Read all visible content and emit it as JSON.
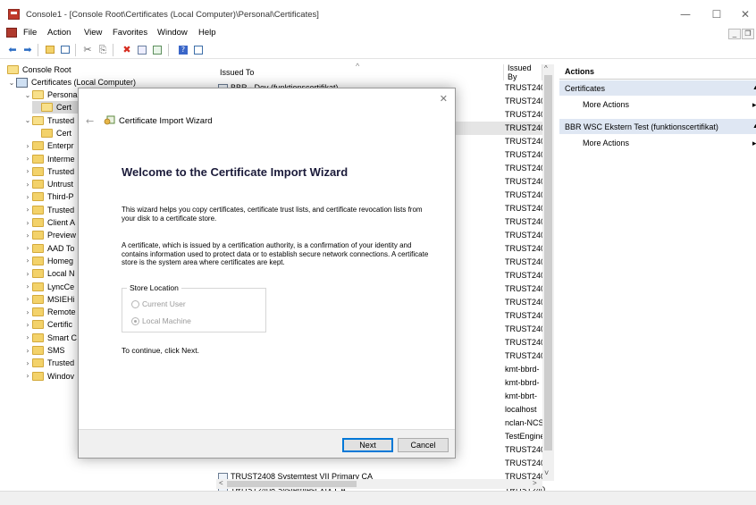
{
  "window": {
    "title": "Console1 - [Console Root\\Certificates (Local Computer)\\Personal\\Certificates]",
    "minimize": "—",
    "maximize": "☐",
    "close": "✕"
  },
  "menu": {
    "items": [
      "File",
      "Action",
      "View",
      "Favorites",
      "Window",
      "Help"
    ],
    "mdi_min": "_",
    "mdi_restore": "❐"
  },
  "toolbar": {
    "icons": [
      "back-arrow-icon",
      "forward-arrow-icon",
      "up-folder-icon",
      "show-hide-tree-icon",
      "cut-icon",
      "copy-icon",
      "delete-icon",
      "properties-icon",
      "export-icon",
      "help-icon",
      "console-icon"
    ]
  },
  "tree": {
    "root": "Console Root",
    "computer": "Certificates (Local Computer)",
    "items": [
      {
        "label": "Persona",
        "twisty": "⌄",
        "indent": 2,
        "open": true
      },
      {
        "label": "Cert",
        "twisty": "",
        "indent": 3,
        "open": true,
        "selected": true
      },
      {
        "label": "Trusted",
        "twisty": "⌄",
        "indent": 2,
        "open": true
      },
      {
        "label": "Cert",
        "twisty": "",
        "indent": 3,
        "open": false
      },
      {
        "label": "Enterpr",
        "twisty": "›",
        "indent": 2
      },
      {
        "label": "Interme",
        "twisty": "›",
        "indent": 2
      },
      {
        "label": "Trusted",
        "twisty": "›",
        "indent": 2
      },
      {
        "label": "Untrust",
        "twisty": "›",
        "indent": 2
      },
      {
        "label": "Third-P",
        "twisty": "›",
        "indent": 2
      },
      {
        "label": "Trusted",
        "twisty": "›",
        "indent": 2
      },
      {
        "label": "Client A",
        "twisty": "›",
        "indent": 2
      },
      {
        "label": "Preview",
        "twisty": "›",
        "indent": 2
      },
      {
        "label": "AAD To",
        "twisty": "›",
        "indent": 2
      },
      {
        "label": "Homeg",
        "twisty": "›",
        "indent": 2
      },
      {
        "label": "Local N",
        "twisty": "›",
        "indent": 2
      },
      {
        "label": "LyncCe",
        "twisty": "›",
        "indent": 2
      },
      {
        "label": "MSIEHi",
        "twisty": "›",
        "indent": 2
      },
      {
        "label": "Remote",
        "twisty": "›",
        "indent": 2
      },
      {
        "label": "Certific",
        "twisty": "›",
        "indent": 2
      },
      {
        "label": "Smart C",
        "twisty": "›",
        "indent": 2
      },
      {
        "label": "SMS",
        "twisty": "›",
        "indent": 2
      },
      {
        "label": "Trusted",
        "twisty": "›",
        "indent": 2
      },
      {
        "label": "Windov",
        "twisty": "›",
        "indent": 2
      }
    ]
  },
  "list": {
    "col_issued_to": "Issued To",
    "col_issued_by": "Issued By",
    "sort_arrow": "^",
    "scroll_up": "^",
    "scroll_down": "˅",
    "scroll_left": "<",
    "scroll_right": ">",
    "rows": [
      {
        "to": "BBR - Dev (funktionscertifikat)",
        "by": "TRUST240"
      },
      {
        "to": "",
        "by": "TRUST240"
      },
      {
        "to": "",
        "by": "TRUST240"
      },
      {
        "to": "",
        "by": "TRUST240",
        "highlight": true
      },
      {
        "to": "",
        "by": "TRUST240"
      },
      {
        "to": "",
        "by": "TRUST240"
      },
      {
        "to": "",
        "by": "TRUST240"
      },
      {
        "to": "",
        "by": "TRUST240"
      },
      {
        "to": "",
        "by": "TRUST240"
      },
      {
        "to": "",
        "by": "TRUST240"
      },
      {
        "to": "",
        "by": "TRUST240"
      },
      {
        "to": "",
        "by": "TRUST240"
      },
      {
        "to": "",
        "by": "TRUST240"
      },
      {
        "to": "",
        "by": "TRUST240"
      },
      {
        "to": "",
        "by": "TRUST240"
      },
      {
        "to": "",
        "by": "TRUST240"
      },
      {
        "to": "",
        "by": "TRUST240"
      },
      {
        "to": "",
        "by": "TRUST240"
      },
      {
        "to": "",
        "by": "TRUST240"
      },
      {
        "to": "",
        "by": "TRUST240"
      },
      {
        "to": "",
        "by": "TRUST240"
      },
      {
        "to": "",
        "by": "kmt-bbrd-"
      },
      {
        "to": "",
        "by": "kmt-bbrd-"
      },
      {
        "to": "",
        "by": "kmt-bbrt-"
      },
      {
        "to": "",
        "by": "localhost"
      },
      {
        "to": "",
        "by": "nclan-NCS"
      },
      {
        "to": "",
        "by": "TestEngine"
      },
      {
        "to": "",
        "by": "TRUST240"
      },
      {
        "to": "",
        "by": "TRUST240"
      },
      {
        "to": "TRUST2408 Systemtest VII Primary CA",
        "by": "TRUST240"
      },
      {
        "to": "TRUST2408 Systemtest XIX CA",
        "by": "TRUST240"
      }
    ]
  },
  "actions": {
    "header": "Actions",
    "section1": "Certificates",
    "section1_item": "More Actions",
    "section2": "BBR WSC Ekstern Test (funktionscertifikat)",
    "section2_item": "More Actions",
    "collapse_arrow": "▲",
    "more_arrow": "▸"
  },
  "wizard": {
    "close": "✕",
    "back": "←",
    "title": "Certificate Import Wizard",
    "heading": "Welcome to the Certificate Import Wizard",
    "para1": "This wizard helps you copy certificates, certificate trust lists, and certificate revocation lists from your disk to a certificate store.",
    "para2": "A certificate, which is issued by a certification authority, is a confirmation of your identity and contains information used to protect data or to establish secure network connections. A certificate store is the system area where certificates are kept.",
    "store_location": "Store Location",
    "option_current_user": "Current User",
    "option_local_machine": "Local Machine",
    "continue_text": "To continue, click Next.",
    "next_button": "Next",
    "cancel_button": "Cancel"
  },
  "colors": {
    "accent": "#0078d7",
    "selection": "#cce8ff",
    "actions_header": "#dfe7f3",
    "folder": "#f3d26a"
  }
}
